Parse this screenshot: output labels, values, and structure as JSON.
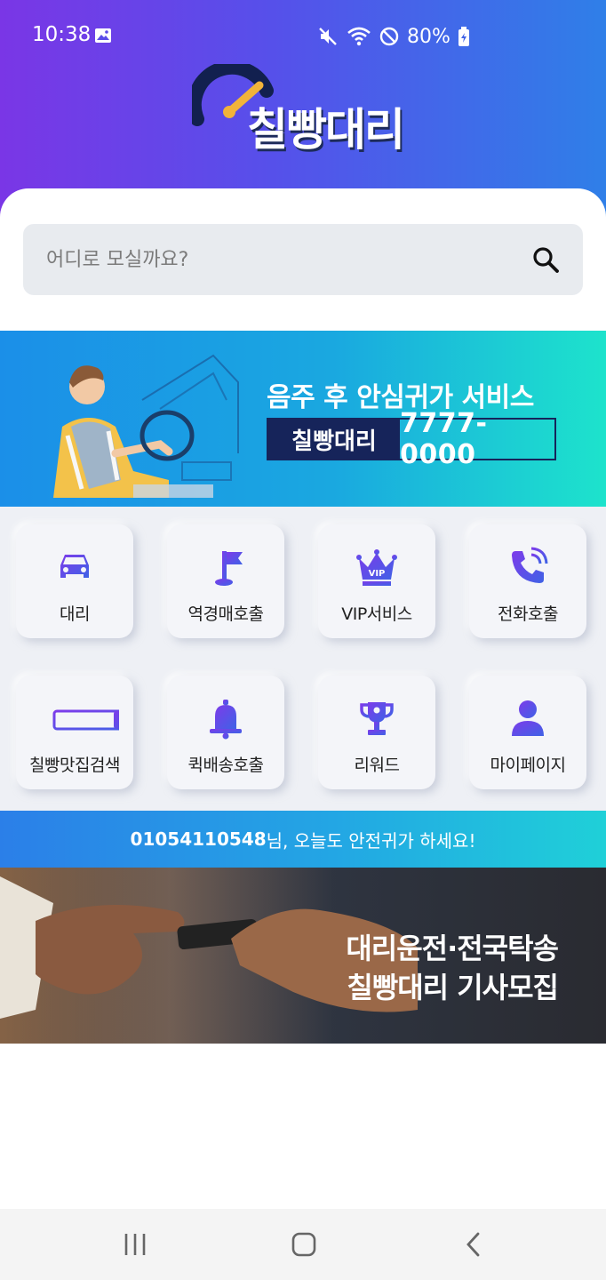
{
  "status": {
    "time": "10:38",
    "battery": "80%"
  },
  "app": {
    "name": "칠빵대리"
  },
  "search": {
    "placeholder": "어디로 모실까요?"
  },
  "banner_top": {
    "title": "음주 후 안심귀가 서비스",
    "brand": "칠빵대리",
    "phone": "7777-0000"
  },
  "menu": [
    {
      "label": "대리",
      "icon": "car-icon"
    },
    {
      "label": "역경매호출",
      "icon": "flag-icon"
    },
    {
      "label": "VIP서비스",
      "icon": "vip-crown-icon"
    },
    {
      "label": "전화호출",
      "icon": "phone-icon"
    },
    {
      "label": "칠빵맛집검색",
      "icon": "search-bar-icon"
    },
    {
      "label": "퀵배송호출",
      "icon": "bell-icon"
    },
    {
      "label": "리워드",
      "icon": "trophy-icon"
    },
    {
      "label": "마이페이지",
      "icon": "user-icon"
    }
  ],
  "greeting": {
    "user": "01054110548",
    "message": "님, 오늘도 안전귀가 하세요!"
  },
  "banner_bottom": {
    "line1": "대리운전·전국탁송",
    "line2": "칠빵대리 기사모집"
  },
  "colors": {
    "accent_purple": "#7a36e6",
    "accent_blue": "#2f7fe8",
    "icon_gradient_start": "#7d3bea",
    "icon_gradient_end": "#3f62e6",
    "banner_navy": "#16245a"
  }
}
